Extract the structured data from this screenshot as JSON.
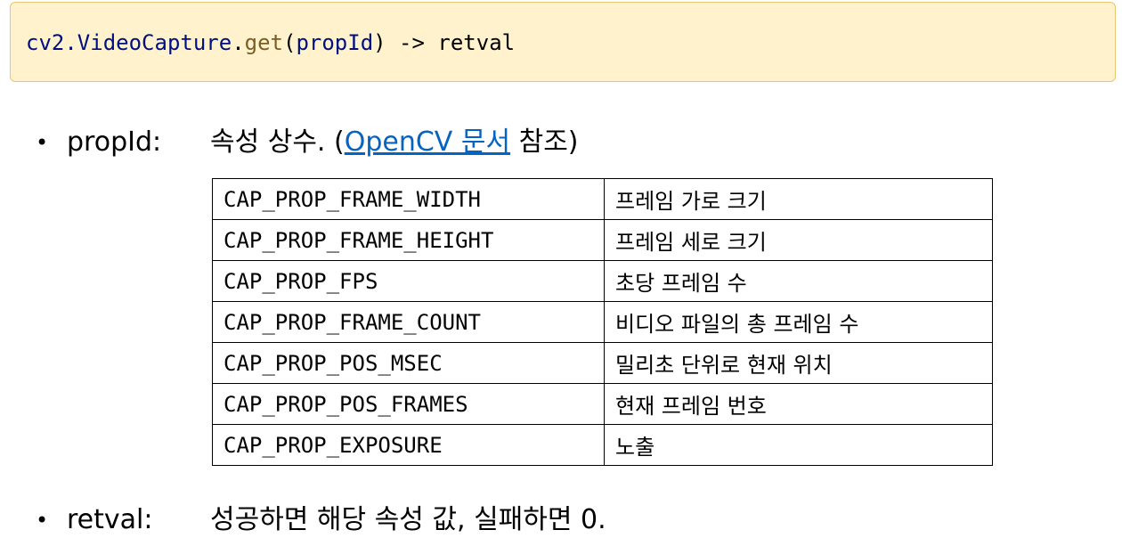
{
  "code": {
    "object": "cv2.VideoCapture",
    "dot": ".",
    "method": "get",
    "open_paren": "(",
    "argument": "propId",
    "close_paren": ")",
    "return_part": " -> retval"
  },
  "params": [
    {
      "label": "propId:",
      "text_before": "속성 상수. (",
      "link_text": "OpenCV 문서",
      "text_after": " 참조)"
    },
    {
      "label": "retval:",
      "text": "성공하면 해당 속성 값, 실패하면 0."
    }
  ],
  "bullet": "•",
  "table": {
    "rows": [
      {
        "constant": "CAP_PROP_FRAME_WIDTH",
        "description": "프레임 가로 크기"
      },
      {
        "constant": "CAP_PROP_FRAME_HEIGHT",
        "description": "프레임 세로 크기"
      },
      {
        "constant": "CAP_PROP_FPS",
        "description": "초당 프레임 수"
      },
      {
        "constant": "CAP_PROP_FRAME_COUNT",
        "description": "비디오 파일의 총 프레임 수"
      },
      {
        "constant": "CAP_PROP_POS_MSEC",
        "description": "밀리초 단위로 현재 위치"
      },
      {
        "constant": "CAP_PROP_POS_FRAMES",
        "description": "현재 프레임 번호"
      },
      {
        "constant": "CAP_PROP_EXPOSURE",
        "description": "노출"
      }
    ]
  },
  "colors": {
    "code_background": "#fff2cc",
    "code_border": "#e6c873",
    "link": "#0563c1",
    "code_method": "#795e26",
    "code_identifier": "#001080"
  }
}
